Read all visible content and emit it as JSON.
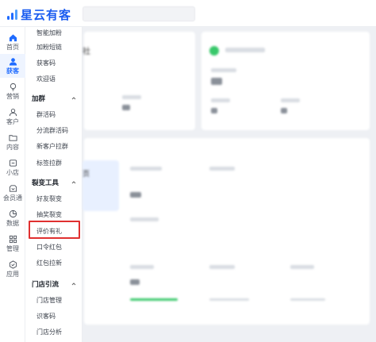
{
  "app": {
    "name": "星云有客",
    "brand_color": "#1f6bff"
  },
  "search": {
    "placeholder": ""
  },
  "rail": {
    "items": [
      {
        "label": "首页",
        "icon": "home-icon",
        "active": false
      },
      {
        "label": "获客",
        "icon": "user-acquire-icon",
        "active": true
      },
      {
        "label": "营销",
        "icon": "bulb-icon",
        "active": false
      },
      {
        "label": "客户",
        "icon": "person-icon",
        "active": false
      },
      {
        "label": "内容",
        "icon": "folder-icon",
        "active": false
      },
      {
        "label": "小店",
        "icon": "shop-icon",
        "active": false
      },
      {
        "label": "会员通",
        "icon": "member-icon",
        "active": false
      },
      {
        "label": "数据",
        "icon": "pie-chart-icon",
        "active": false
      },
      {
        "label": "管理",
        "icon": "grid-icon",
        "active": false
      },
      {
        "label": "应用",
        "icon": "app-icon",
        "active": false
      }
    ]
  },
  "submenu": {
    "top_items": [
      "智能加粉",
      "加粉短链",
      "获客码",
      "欢迎语"
    ],
    "groups": [
      {
        "title": "加群",
        "items": [
          "群活码",
          "分流群活码",
          "新客户拉群",
          "标签拉群"
        ]
      },
      {
        "title": "裂变工具",
        "items": [
          "好友裂变",
          "抽奖裂变",
          "评价有礼",
          "口令红包",
          "红包拉新"
        ]
      },
      {
        "title": "门店引流",
        "items": [
          "门店管理",
          "识客码",
          "门店分析"
        ]
      }
    ],
    "highlighted_item": "评价有礼",
    "highlight_color": "#e03030"
  },
  "main": {
    "fragments": [
      "社",
      "页"
    ]
  }
}
